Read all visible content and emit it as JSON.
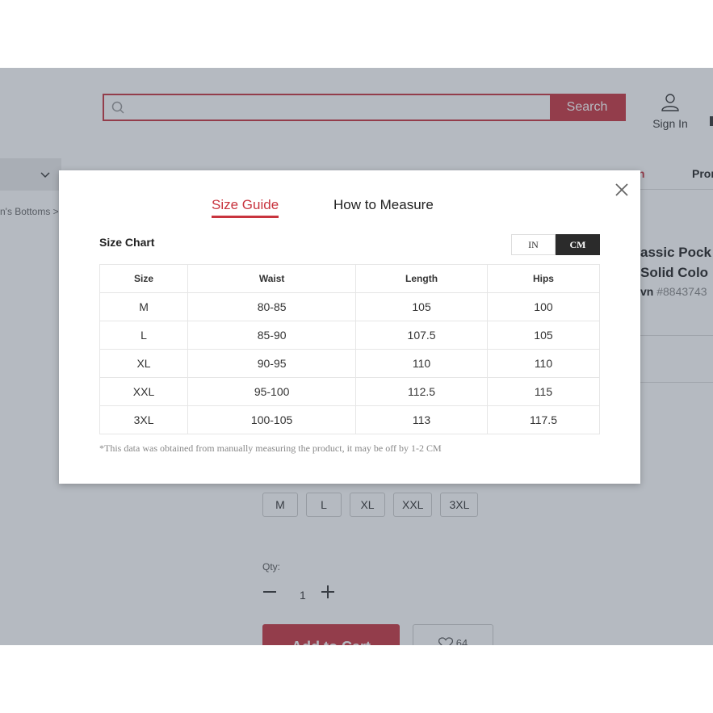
{
  "header": {
    "search_placeholder": "",
    "search_button": "Search",
    "sign_in": "Sign In"
  },
  "nav": {
    "item_red_partial": "n",
    "item_partial": "Pron"
  },
  "breadcrumb": "n's Bottoms  >",
  "product": {
    "title_line1": "assic Pock",
    "title_line2": "Solid Colo",
    "brand_partial": "vn",
    "code": "#8843743"
  },
  "sizes": [
    "M",
    "L",
    "XL",
    "XXL",
    "3XL"
  ],
  "quantity": {
    "label": "Qty:",
    "value": "1"
  },
  "add_to_cart": "Add to Cart",
  "wishlist_count": "64",
  "modal": {
    "tabs": {
      "size_guide": "Size Guide",
      "how_to_measure": "How to Measure"
    },
    "chart_title": "Size Chart",
    "units": {
      "in": "IN",
      "cm": "CM",
      "selected": "CM"
    },
    "table": {
      "headers": [
        "Size",
        "Waist",
        "Length",
        "Hips"
      ],
      "rows": [
        [
          "M",
          "80-85",
          "105",
          "100"
        ],
        [
          "L",
          "85-90",
          "107.5",
          "105"
        ],
        [
          "XL",
          "90-95",
          "110",
          "110"
        ],
        [
          "XXL",
          "95-100",
          "112.5",
          "115"
        ],
        [
          "3XL",
          "100-105",
          "113",
          "117.5"
        ]
      ]
    },
    "disclaimer": "*This data was obtained from manually measuring the product, it may be off by 1-2 CM"
  },
  "colors": {
    "accent": "#c8343e",
    "dark": "#2b2b2b"
  }
}
